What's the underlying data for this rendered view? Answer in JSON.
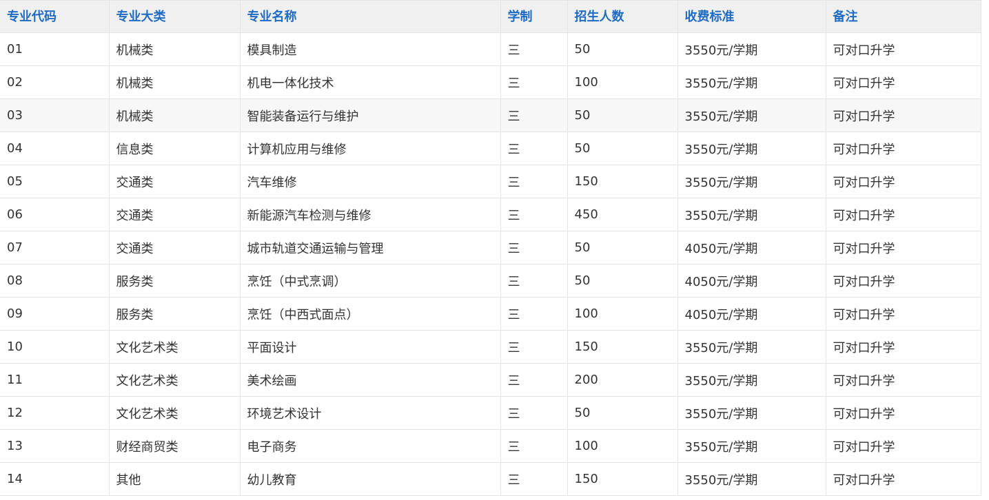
{
  "table": {
    "headers": [
      "专业代码",
      "专业大类",
      "专业名称",
      "学制",
      "招生人数",
      "收费标准",
      "备注"
    ],
    "rows": [
      [
        "01",
        "机械类",
        "模具制造",
        "三",
        "50",
        "3550元/学期",
        "可对口升学"
      ],
      [
        "02",
        "机械类",
        "机电一体化技术",
        "三",
        "100",
        "3550元/学期",
        "可对口升学"
      ],
      [
        "03",
        "机械类",
        "智能装备运行与维护",
        "三",
        "50",
        "3550元/学期",
        "可对口升学"
      ],
      [
        "04",
        "信息类",
        "计算机应用与维修",
        "三",
        "50",
        "3550元/学期",
        "可对口升学"
      ],
      [
        "05",
        "交通类",
        "汽车维修",
        "三",
        "150",
        "3550元/学期",
        "可对口升学"
      ],
      [
        "06",
        "交通类",
        "新能源汽车检测与维修",
        "三",
        "450",
        "3550元/学期",
        "可对口升学"
      ],
      [
        "07",
        "交通类",
        "城市轨道交通运输与管理",
        "三",
        "50",
        "4050元/学期",
        "可对口升学"
      ],
      [
        "08",
        "服务类",
        "烹饪（中式烹调）",
        "三",
        "50",
        "4050元/学期",
        "可对口升学"
      ],
      [
        "09",
        "服务类",
        "烹饪（中西式面点）",
        "三",
        "100",
        "4050元/学期",
        "可对口升学"
      ],
      [
        "10",
        "文化艺术类",
        "平面设计",
        "三",
        "150",
        "3550元/学期",
        "可对口升学"
      ],
      [
        "11",
        "文化艺术类",
        "美术绘画",
        "三",
        "200",
        "3550元/学期",
        "可对口升学"
      ],
      [
        "12",
        "文化艺术类",
        "环境艺术设计",
        "三",
        "50",
        "3550元/学期",
        "可对口升学"
      ],
      [
        "13",
        "财经商贸类",
        "电子商务",
        "三",
        "100",
        "3550元/学期",
        "可对口升学"
      ],
      [
        "14",
        "其他",
        "幼儿教育",
        "三",
        "150",
        "3550元/学期",
        "可对口升学"
      ]
    ],
    "highlighted_row_index": 2,
    "colors": {
      "header_text": "#1e6bc4",
      "header_background": "#f0f0f0",
      "cell_text": "#333333",
      "border": "#e4e4e4",
      "highlight_background": "#f7f7f7"
    }
  }
}
